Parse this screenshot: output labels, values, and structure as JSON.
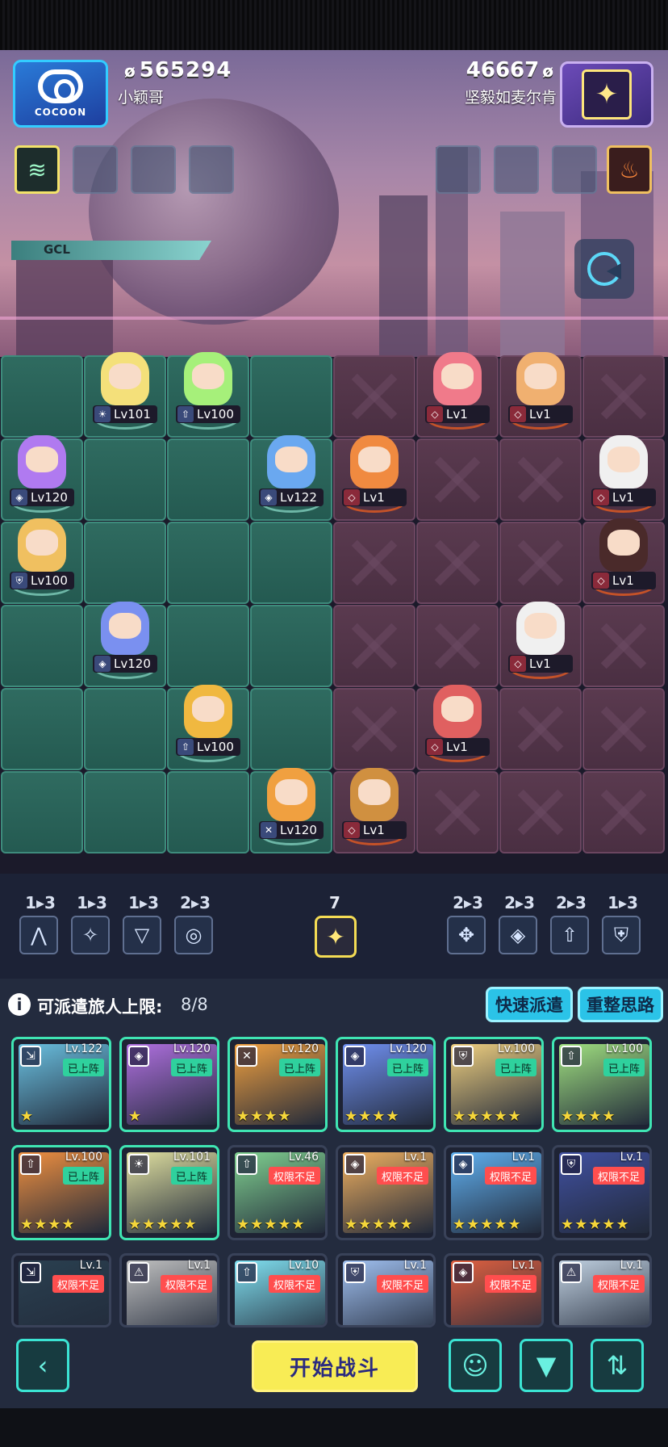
{
  "header": {
    "logo_text": "COCOON",
    "left_score": "565294",
    "left_name": "小颖哥",
    "right_score": "46667",
    "right_name": "坚毅如麦尔肯",
    "gcl_label": "GCL"
  },
  "icons": {
    "coin": "coin-icon",
    "opponent_avatar": "sparkle-icon",
    "mini_game": "pacman-icon"
  },
  "board": {
    "ally_units": [
      {
        "level": "Lv101",
        "cls": "sun"
      },
      {
        "level": "Lv100",
        "cls": "arrow"
      },
      {
        "level": "Lv120",
        "cls": "diamond"
      },
      {
        "level": "Lv122",
        "cls": "diamond"
      },
      {
        "level": "Lv100",
        "cls": "shield"
      },
      {
        "level": "Lv120",
        "cls": "diamond"
      },
      {
        "level": "Lv100",
        "cls": "arrow"
      },
      {
        "level": "Lv120",
        "cls": "sword"
      }
    ],
    "enemy_units": [
      {
        "level": "Lv1"
      },
      {
        "level": "Lv1"
      },
      {
        "level": "Lv1"
      },
      {
        "level": "Lv1"
      },
      {
        "level": "Lv1"
      },
      {
        "level": "Lv1"
      },
      {
        "level": "Lv1"
      },
      {
        "level": "Lv1"
      }
    ]
  },
  "class_bar": {
    "left": [
      "1▸3",
      "1▸3",
      "1▸3",
      "2▸3"
    ],
    "center_count": "7",
    "right": [
      "2▸3",
      "2▸3",
      "2▸3",
      "1▸3"
    ]
  },
  "dispatch": {
    "info_icon": "i",
    "limit_label": "可派遣旅人上限:",
    "limit_value": "8/8",
    "quick_dispatch": "快速派遣",
    "rearrange": "重整思路"
  },
  "cards": [
    {
      "level": "Lv.122",
      "tag": "已上阵",
      "stars": "★",
      "state": "on"
    },
    {
      "level": "Lv.120",
      "tag": "已上阵",
      "stars": "★",
      "state": "on"
    },
    {
      "level": "Lv.120",
      "tag": "已上阵",
      "stars": "★★★★",
      "state": "on"
    },
    {
      "level": "Lv.120",
      "tag": "已上阵",
      "stars": "★★★★",
      "state": "on"
    },
    {
      "level": "Lv.100",
      "tag": "已上阵",
      "stars": "★★★★★",
      "state": "on"
    },
    {
      "level": "Lv.100",
      "tag": "已上阵",
      "stars": "★★★★",
      "state": "on"
    },
    {
      "level": "Lv.100",
      "tag": "已上阵",
      "stars": "★★★★",
      "state": "on"
    },
    {
      "level": "Lv.101",
      "tag": "已上阵",
      "stars": "★★★★★",
      "state": "on"
    },
    {
      "level": "Lv.46",
      "tag": "权限不足",
      "stars": "★★★★★",
      "state": "off"
    },
    {
      "level": "Lv.1",
      "tag": "权限不足",
      "stars": "★★★★★",
      "state": "off"
    },
    {
      "level": "Lv.1",
      "tag": "权限不足",
      "stars": "★★★★★",
      "state": "off"
    },
    {
      "level": "Lv.1",
      "tag": "权限不足",
      "stars": "★★★★★",
      "state": "off"
    },
    {
      "level": "Lv.1",
      "tag": "权限不足",
      "stars": "",
      "state": "off"
    },
    {
      "level": "Lv.1",
      "tag": "权限不足",
      "stars": "",
      "state": "off"
    },
    {
      "level": "Lv.10",
      "tag": "权限不足",
      "stars": "",
      "state": "off"
    },
    {
      "level": "Lv.1",
      "tag": "权限不足",
      "stars": "",
      "state": "off"
    },
    {
      "level": "Lv.1",
      "tag": "权限不足",
      "stars": "",
      "state": "off"
    },
    {
      "level": "Lv.1",
      "tag": "权限不足",
      "stars": "",
      "state": "off"
    }
  ],
  "footer": {
    "start_battle": "开始战斗"
  },
  "colors": {
    "ally_tile": "#2f6b60",
    "enemy_tile": "#5a3a4f",
    "deployed_border": "#3fe5b3",
    "locked_tag": "#ff4e4e",
    "start_button": "#f8ec55"
  }
}
